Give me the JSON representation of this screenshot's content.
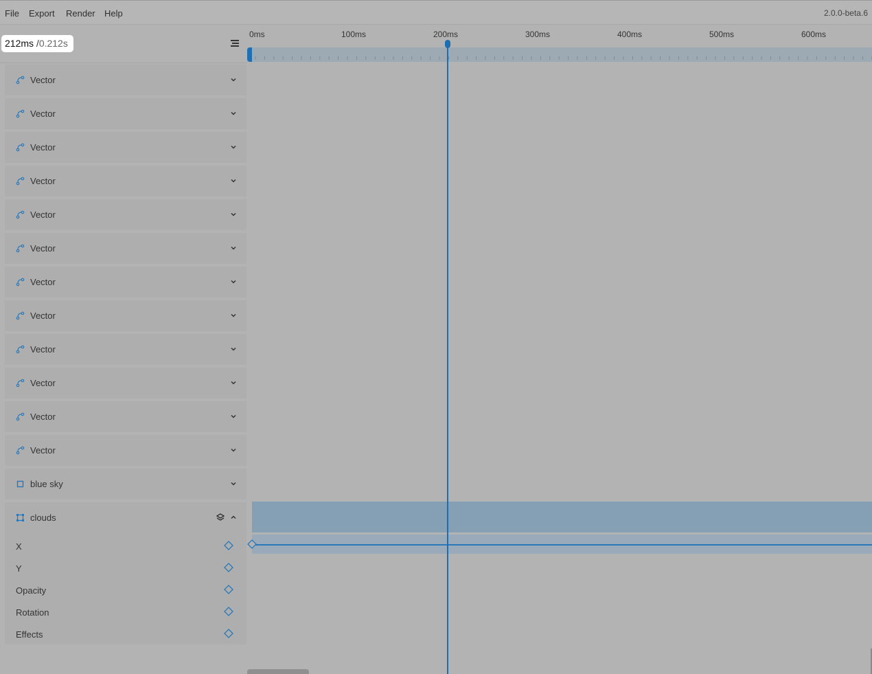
{
  "menu": {
    "items": [
      "File",
      "Export",
      "Render",
      "Help"
    ],
    "version": "2.0.0-beta.6"
  },
  "time": {
    "ms": "212ms",
    "sep": " /",
    "seconds": "0.212s"
  },
  "ruler": {
    "labels": [
      "0ms",
      "100ms",
      "200ms",
      "300ms",
      "400ms",
      "500ms",
      "600ms"
    ]
  },
  "layers": [
    {
      "name": "Vector",
      "icon": "vector-path-icon"
    },
    {
      "name": "Vector",
      "icon": "vector-path-icon"
    },
    {
      "name": "Vector",
      "icon": "vector-path-icon"
    },
    {
      "name": "Vector",
      "icon": "vector-path-icon"
    },
    {
      "name": "Vector",
      "icon": "vector-path-icon"
    },
    {
      "name": "Vector",
      "icon": "vector-path-icon"
    },
    {
      "name": "Vector",
      "icon": "vector-path-icon"
    },
    {
      "name": "Vector",
      "icon": "vector-path-icon"
    },
    {
      "name": "Vector",
      "icon": "vector-path-icon"
    },
    {
      "name": "Vector",
      "icon": "vector-path-icon"
    },
    {
      "name": "Vector",
      "icon": "vector-path-icon"
    },
    {
      "name": "Vector",
      "icon": "vector-path-icon"
    },
    {
      "name": "blue sky",
      "icon": "rectangle-icon"
    },
    {
      "name": "clouds",
      "icon": "group-icon",
      "expanded": true
    }
  ],
  "properties": [
    "X",
    "Y",
    "Opacity",
    "Rotation",
    "Effects"
  ],
  "colors": {
    "accent": "#1d6eb0",
    "track": "#9daab4",
    "clip": "#85a0b4"
  }
}
